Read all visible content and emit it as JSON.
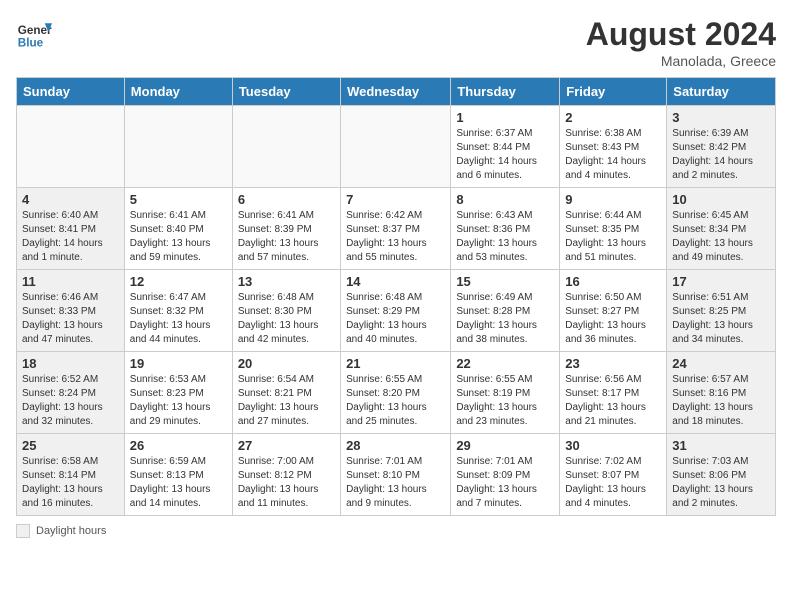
{
  "header": {
    "logo_general": "General",
    "logo_blue": "Blue",
    "month_year": "August 2024",
    "location": "Manolada, Greece"
  },
  "weekdays": [
    "Sunday",
    "Monday",
    "Tuesday",
    "Wednesday",
    "Thursday",
    "Friday",
    "Saturday"
  ],
  "weeks": [
    [
      {
        "day": "",
        "info": ""
      },
      {
        "day": "",
        "info": ""
      },
      {
        "day": "",
        "info": ""
      },
      {
        "day": "",
        "info": ""
      },
      {
        "day": "1",
        "info": "Sunrise: 6:37 AM\nSunset: 8:44 PM\nDaylight: 14 hours\nand 6 minutes."
      },
      {
        "day": "2",
        "info": "Sunrise: 6:38 AM\nSunset: 8:43 PM\nDaylight: 14 hours\nand 4 minutes."
      },
      {
        "day": "3",
        "info": "Sunrise: 6:39 AM\nSunset: 8:42 PM\nDaylight: 14 hours\nand 2 minutes."
      }
    ],
    [
      {
        "day": "4",
        "info": "Sunrise: 6:40 AM\nSunset: 8:41 PM\nDaylight: 14 hours\nand 1 minute."
      },
      {
        "day": "5",
        "info": "Sunrise: 6:41 AM\nSunset: 8:40 PM\nDaylight: 13 hours\nand 59 minutes."
      },
      {
        "day": "6",
        "info": "Sunrise: 6:41 AM\nSunset: 8:39 PM\nDaylight: 13 hours\nand 57 minutes."
      },
      {
        "day": "7",
        "info": "Sunrise: 6:42 AM\nSunset: 8:37 PM\nDaylight: 13 hours\nand 55 minutes."
      },
      {
        "day": "8",
        "info": "Sunrise: 6:43 AM\nSunset: 8:36 PM\nDaylight: 13 hours\nand 53 minutes."
      },
      {
        "day": "9",
        "info": "Sunrise: 6:44 AM\nSunset: 8:35 PM\nDaylight: 13 hours\nand 51 minutes."
      },
      {
        "day": "10",
        "info": "Sunrise: 6:45 AM\nSunset: 8:34 PM\nDaylight: 13 hours\nand 49 minutes."
      }
    ],
    [
      {
        "day": "11",
        "info": "Sunrise: 6:46 AM\nSunset: 8:33 PM\nDaylight: 13 hours\nand 47 minutes."
      },
      {
        "day": "12",
        "info": "Sunrise: 6:47 AM\nSunset: 8:32 PM\nDaylight: 13 hours\nand 44 minutes."
      },
      {
        "day": "13",
        "info": "Sunrise: 6:48 AM\nSunset: 8:30 PM\nDaylight: 13 hours\nand 42 minutes."
      },
      {
        "day": "14",
        "info": "Sunrise: 6:48 AM\nSunset: 8:29 PM\nDaylight: 13 hours\nand 40 minutes."
      },
      {
        "day": "15",
        "info": "Sunrise: 6:49 AM\nSunset: 8:28 PM\nDaylight: 13 hours\nand 38 minutes."
      },
      {
        "day": "16",
        "info": "Sunrise: 6:50 AM\nSunset: 8:27 PM\nDaylight: 13 hours\nand 36 minutes."
      },
      {
        "day": "17",
        "info": "Sunrise: 6:51 AM\nSunset: 8:25 PM\nDaylight: 13 hours\nand 34 minutes."
      }
    ],
    [
      {
        "day": "18",
        "info": "Sunrise: 6:52 AM\nSunset: 8:24 PM\nDaylight: 13 hours\nand 32 minutes."
      },
      {
        "day": "19",
        "info": "Sunrise: 6:53 AM\nSunset: 8:23 PM\nDaylight: 13 hours\nand 29 minutes."
      },
      {
        "day": "20",
        "info": "Sunrise: 6:54 AM\nSunset: 8:21 PM\nDaylight: 13 hours\nand 27 minutes."
      },
      {
        "day": "21",
        "info": "Sunrise: 6:55 AM\nSunset: 8:20 PM\nDaylight: 13 hours\nand 25 minutes."
      },
      {
        "day": "22",
        "info": "Sunrise: 6:55 AM\nSunset: 8:19 PM\nDaylight: 13 hours\nand 23 minutes."
      },
      {
        "day": "23",
        "info": "Sunrise: 6:56 AM\nSunset: 8:17 PM\nDaylight: 13 hours\nand 21 minutes."
      },
      {
        "day": "24",
        "info": "Sunrise: 6:57 AM\nSunset: 8:16 PM\nDaylight: 13 hours\nand 18 minutes."
      }
    ],
    [
      {
        "day": "25",
        "info": "Sunrise: 6:58 AM\nSunset: 8:14 PM\nDaylight: 13 hours\nand 16 minutes."
      },
      {
        "day": "26",
        "info": "Sunrise: 6:59 AM\nSunset: 8:13 PM\nDaylight: 13 hours\nand 14 minutes."
      },
      {
        "day": "27",
        "info": "Sunrise: 7:00 AM\nSunset: 8:12 PM\nDaylight: 13 hours\nand 11 minutes."
      },
      {
        "day": "28",
        "info": "Sunrise: 7:01 AM\nSunset: 8:10 PM\nDaylight: 13 hours\nand 9 minutes."
      },
      {
        "day": "29",
        "info": "Sunrise: 7:01 AM\nSunset: 8:09 PM\nDaylight: 13 hours\nand 7 minutes."
      },
      {
        "day": "30",
        "info": "Sunrise: 7:02 AM\nSunset: 8:07 PM\nDaylight: 13 hours\nand 4 minutes."
      },
      {
        "day": "31",
        "info": "Sunrise: 7:03 AM\nSunset: 8:06 PM\nDaylight: 13 hours\nand 2 minutes."
      }
    ]
  ],
  "footer": {
    "daylight_label": "Daylight hours"
  }
}
